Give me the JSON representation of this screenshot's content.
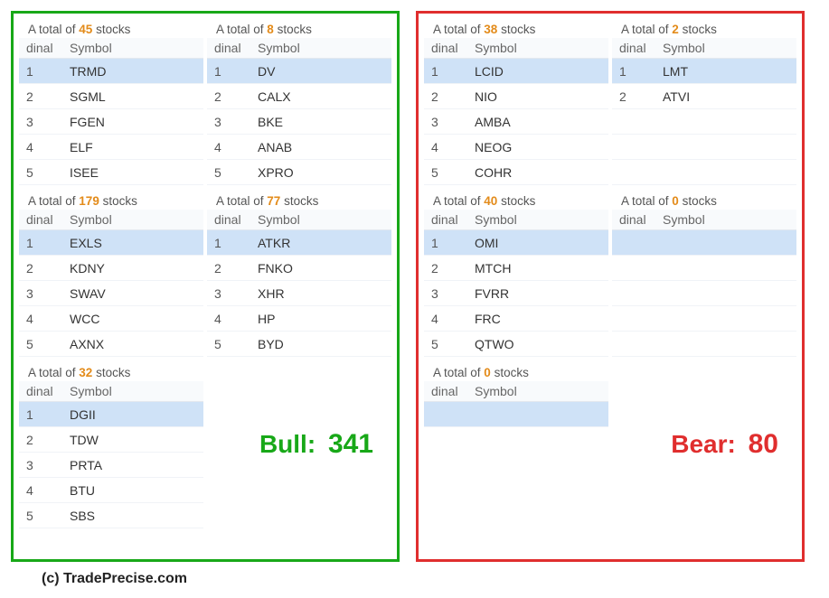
{
  "labels": {
    "count_prefix": "A total of ",
    "count_suffix": " stocks",
    "ordinal_header_trunc": "dinal",
    "symbol_header": "Symbol"
  },
  "bull": {
    "title_label": "Bull:",
    "total": "341",
    "col1": [
      {
        "count": "45",
        "rows": [
          {
            "n": "1",
            "sym": "TRMD"
          },
          {
            "n": "2",
            "sym": "SGML"
          },
          {
            "n": "3",
            "sym": "FGEN"
          },
          {
            "n": "4",
            "sym": "ELF"
          },
          {
            "n": "5",
            "sym": "ISEE"
          }
        ]
      },
      {
        "count": "179",
        "rows": [
          {
            "n": "1",
            "sym": "EXLS"
          },
          {
            "n": "2",
            "sym": "KDNY"
          },
          {
            "n": "3",
            "sym": "SWAV"
          },
          {
            "n": "4",
            "sym": "WCC"
          },
          {
            "n": "5",
            "sym": "AXNX"
          }
        ]
      },
      {
        "count": "32",
        "rows": [
          {
            "n": "1",
            "sym": "DGII"
          },
          {
            "n": "2",
            "sym": "TDW"
          },
          {
            "n": "3",
            "sym": "PRTA"
          },
          {
            "n": "4",
            "sym": "BTU"
          },
          {
            "n": "5",
            "sym": "SBS"
          }
        ]
      }
    ],
    "col2": [
      {
        "count": "8",
        "rows": [
          {
            "n": "1",
            "sym": "DV"
          },
          {
            "n": "2",
            "sym": "CALX"
          },
          {
            "n": "3",
            "sym": "BKE"
          },
          {
            "n": "4",
            "sym": "ANAB"
          },
          {
            "n": "5",
            "sym": "XPRO"
          }
        ]
      },
      {
        "count": "77",
        "rows": [
          {
            "n": "1",
            "sym": "ATKR"
          },
          {
            "n": "2",
            "sym": "FNKO"
          },
          {
            "n": "3",
            "sym": "XHR"
          },
          {
            "n": "4",
            "sym": "HP"
          },
          {
            "n": "5",
            "sym": "BYD"
          }
        ]
      }
    ]
  },
  "bear": {
    "title_label": "Bear:",
    "total": "80",
    "col1": [
      {
        "count": "38",
        "rows": [
          {
            "n": "1",
            "sym": "LCID"
          },
          {
            "n": "2",
            "sym": "NIO"
          },
          {
            "n": "3",
            "sym": "AMBA"
          },
          {
            "n": "4",
            "sym": "NEOG"
          },
          {
            "n": "5",
            "sym": "COHR"
          }
        ]
      },
      {
        "count": "40",
        "rows": [
          {
            "n": "1",
            "sym": "OMI"
          },
          {
            "n": "2",
            "sym": "MTCH"
          },
          {
            "n": "3",
            "sym": "FVRR"
          },
          {
            "n": "4",
            "sym": "FRC"
          },
          {
            "n": "5",
            "sym": "QTWO"
          }
        ]
      },
      {
        "count": "0",
        "rows": []
      }
    ],
    "col2": [
      {
        "count": "2",
        "rows": [
          {
            "n": "1",
            "sym": "LMT"
          },
          {
            "n": "2",
            "sym": "ATVI"
          }
        ],
        "pad": 3
      },
      {
        "count": "0",
        "rows": [],
        "pad": 5
      }
    ]
  },
  "footer": "(c) TradePrecise.com"
}
